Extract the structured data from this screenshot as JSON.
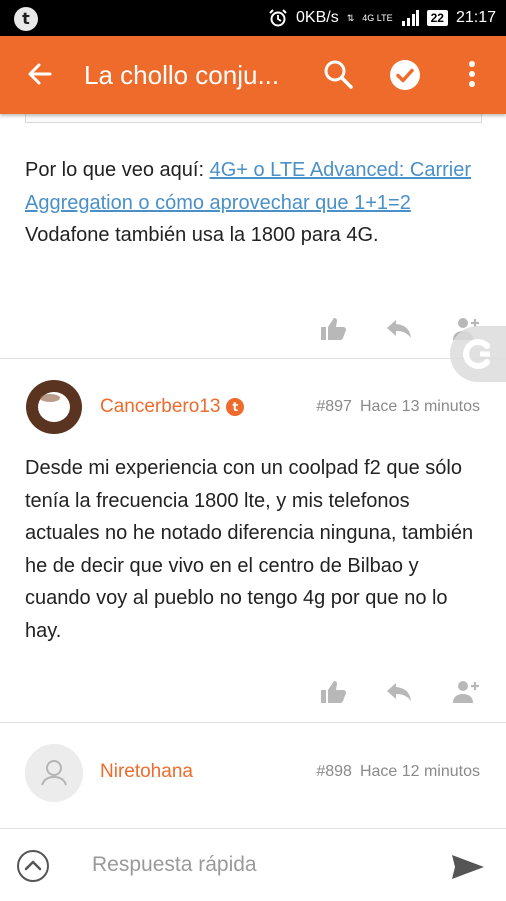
{
  "status_bar": {
    "app_icon_letter": "t",
    "network_speed": "0KB/s",
    "network_type": "4G LTE",
    "battery": "22",
    "time": "21:17"
  },
  "app_bar": {
    "title": "La chollo conju...",
    "back_icon": "arrow-back-icon",
    "search_icon": "search-icon",
    "check_icon": "check-circle-icon",
    "more_icon": "more-vert-icon"
  },
  "posts": [
    {
      "text_before": "Por lo que veo aquí: ",
      "link": "4G+ o LTE Advanced: Carrier Aggregation o cómo aprovechar que 1+1=2",
      "text_after": " Vodafone también usa la 1800 para 4G."
    },
    {
      "username": "Cancerbero13",
      "badge": "t",
      "number": "#897",
      "time": "Hace 13 minutos",
      "text": "Desde mi experiencia con un coolpad f2 que sólo tenía la frecuencia 1800 lte, y mis telefonos actuales no he notado diferencia ninguna, también he de decir que vivo en el centro de Bilbao y cuando voy al pueblo no tengo 4g por que no lo hay."
    },
    {
      "username": "Niretohana",
      "number": "#898",
      "time": "Hace 12 minutos",
      "text": ""
    }
  ],
  "reply_bar": {
    "placeholder": "Respuesta rápida"
  },
  "colors": {
    "accent": "#ef6b2b",
    "link": "#4a90c8"
  }
}
